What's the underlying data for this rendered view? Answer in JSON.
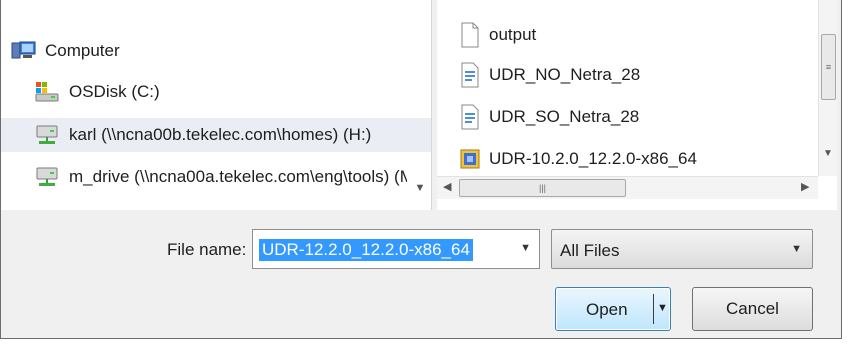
{
  "navigation": {
    "items": [
      {
        "label": "Computer",
        "icon": "computer-icon",
        "selected": false
      },
      {
        "label": "OSDisk (C:)",
        "icon": "local-disk-icon",
        "selected": false
      },
      {
        "label": "karl (\\\\ncna00b.tekelec.com\\homes) (H:)",
        "icon": "network-drive-icon",
        "selected": true
      },
      {
        "label": "m_drive (\\\\ncna00a.tekelec.com\\eng\\tools) (M",
        "icon": "network-drive-icon",
        "selected": false
      }
    ]
  },
  "files": {
    "items": [
      {
        "name": "output",
        "icon": "blank-file-icon"
      },
      {
        "name": "UDR_NO_Netra_28",
        "icon": "text-file-icon"
      },
      {
        "name": "UDR_SO_Netra_28",
        "icon": "text-file-icon"
      },
      {
        "name": "UDR-10.2.0_12.2.0-x86_64",
        "icon": "archive-file-icon"
      }
    ]
  },
  "filename": {
    "label": "File name:",
    "value": "UDR-12.2.0_12.2.0-x86_64"
  },
  "filetype": {
    "selected": "All Files"
  },
  "buttons": {
    "open": "Open",
    "cancel": "Cancel"
  },
  "colors": {
    "selection_blue": "#3399ff",
    "button_accent": "#3c7fb1"
  }
}
